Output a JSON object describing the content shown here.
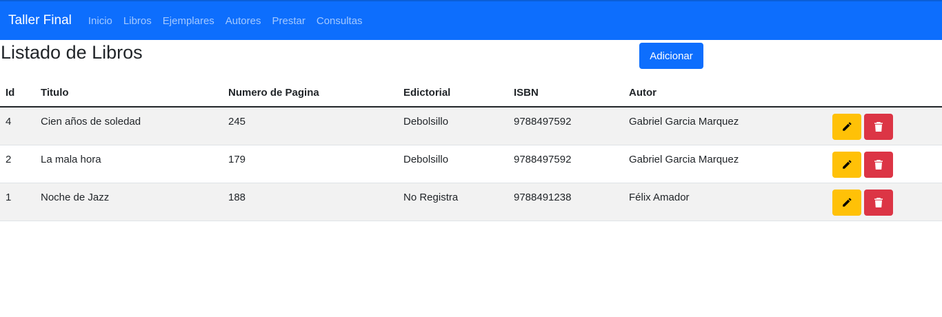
{
  "navbar": {
    "brand": "Taller Final",
    "links": [
      "Inicio",
      "Libros",
      "Ejemplares",
      "Autores",
      "Prestar",
      "Consultas"
    ]
  },
  "page": {
    "title": "Listado de Libros",
    "add_label": "Adicionar"
  },
  "table": {
    "headers": [
      "Id",
      "Titulo",
      "Numero de Pagina",
      "Edictorial",
      "ISBN",
      "Autor"
    ],
    "rows": [
      {
        "id": "4",
        "titulo": "Cien años de soledad",
        "paginas": "245",
        "editorial": "Debolsillo",
        "isbn": "9788497592",
        "autor": "Gabriel Garcia Marquez"
      },
      {
        "id": "2",
        "titulo": "La mala hora",
        "paginas": "179",
        "editorial": "Debolsillo",
        "isbn": "9788497592",
        "autor": "Gabriel Garcia Marquez"
      },
      {
        "id": "1",
        "titulo": "Noche de Jazz",
        "paginas": "188",
        "editorial": "No Registra",
        "isbn": "9788491238",
        "autor": "Félix Amador"
      }
    ],
    "row_actions": {
      "edit_icon": "pencil-icon",
      "delete_icon": "trash-icon"
    }
  },
  "colors": {
    "primary": "#0d6efd",
    "warning": "#ffc107",
    "danger": "#dc3545",
    "stripe": "#f2f2f2"
  }
}
